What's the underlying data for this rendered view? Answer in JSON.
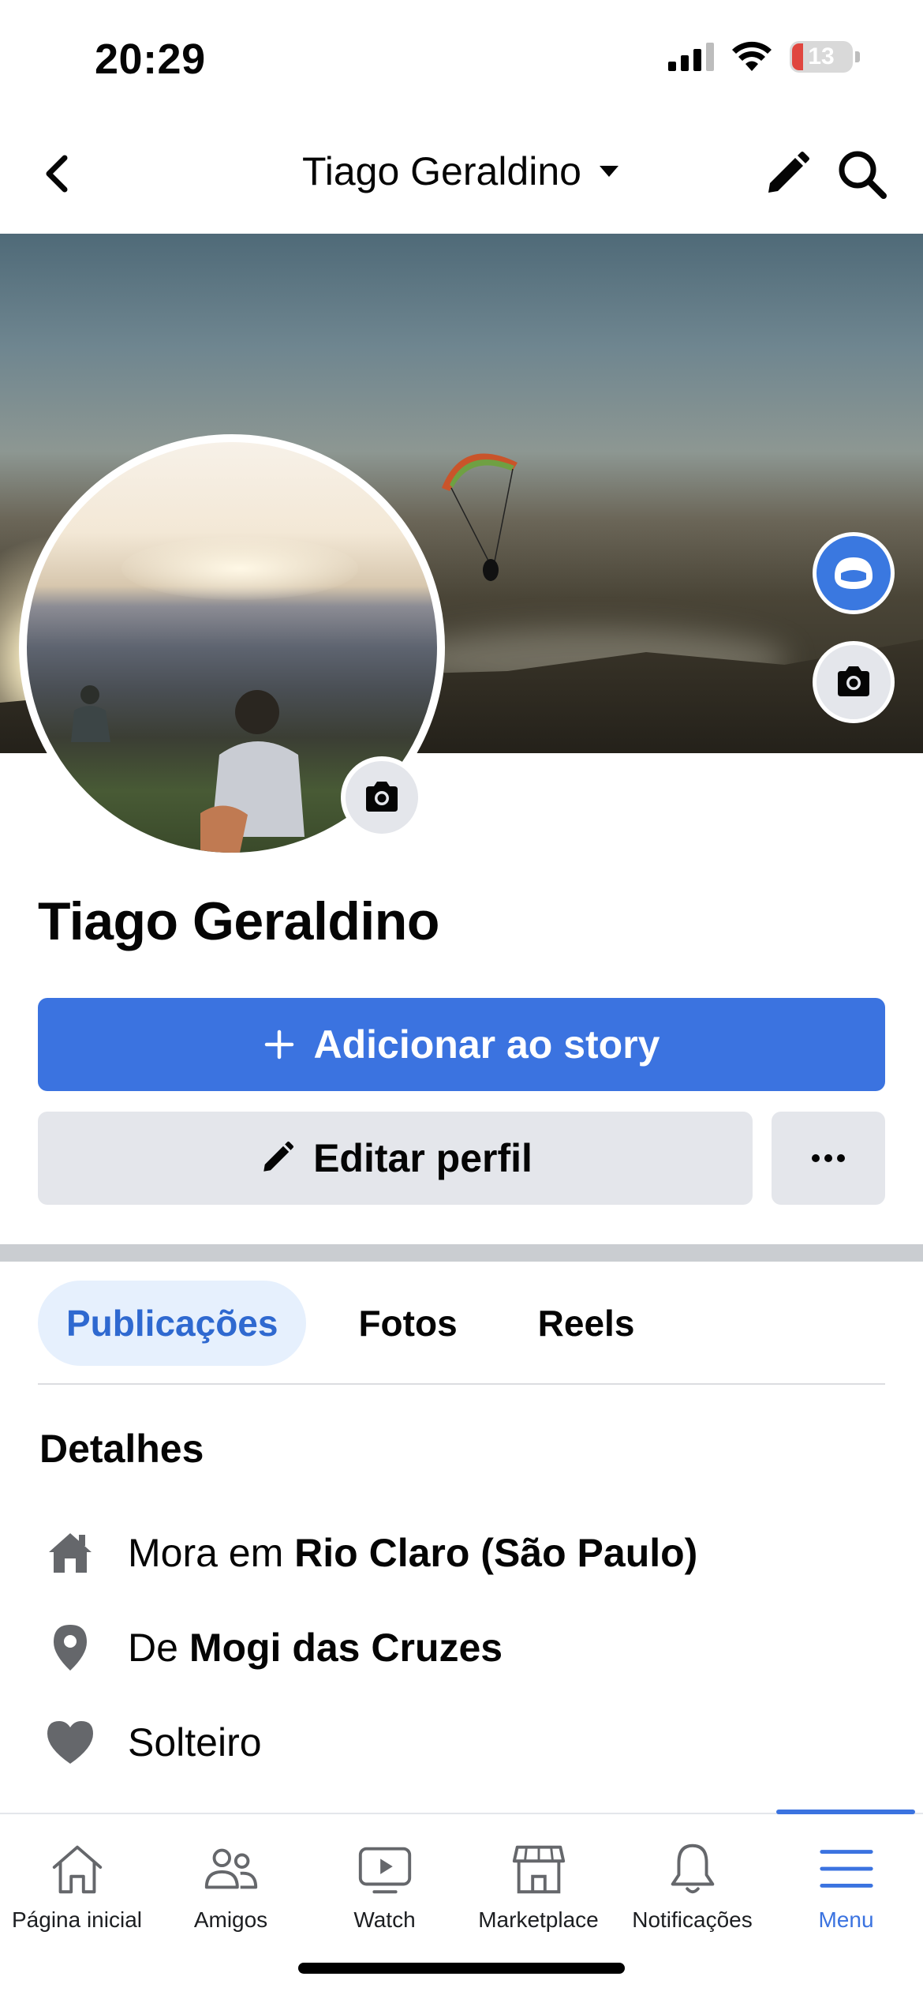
{
  "status_bar": {
    "time": "20:29",
    "battery_level": "13",
    "icons": [
      "signal-icon",
      "wifi-icon",
      "battery-icon"
    ]
  },
  "header": {
    "title": "Tiago Geraldino",
    "icons": [
      "back-chevron-icon",
      "caret-down-icon",
      "pencil-icon",
      "search-icon"
    ]
  },
  "profile": {
    "name": "Tiago Geraldino"
  },
  "actions": {
    "add_story_label": "Adicionar ao story",
    "edit_profile_label": "Editar perfil",
    "more_label": "•••"
  },
  "tabs": [
    {
      "label": "Publicações",
      "active": true
    },
    {
      "label": "Fotos",
      "active": false
    },
    {
      "label": "Reels",
      "active": false
    }
  ],
  "details": {
    "title": "Detalhes",
    "items": [
      {
        "icon": "house-icon",
        "prefix": "Mora em ",
        "value": "Rio Claro (São Paulo)"
      },
      {
        "icon": "location-pin-icon",
        "prefix": "De ",
        "value": "Mogi das Cruzes"
      },
      {
        "icon": "heart-icon",
        "prefix": "Solteiro",
        "value": ""
      }
    ]
  },
  "bottom_nav": [
    {
      "label": "Página inicial",
      "icon": "home-icon",
      "active": false
    },
    {
      "label": "Amigos",
      "icon": "friends-icon",
      "active": false
    },
    {
      "label": "Watch",
      "icon": "watch-icon",
      "active": false
    },
    {
      "label": "Marketplace",
      "icon": "marketplace-icon",
      "active": false
    },
    {
      "label": "Notificações",
      "icon": "bell-icon",
      "active": false
    },
    {
      "label": "Menu",
      "icon": "menu-icon",
      "active": true
    }
  ],
  "colors": {
    "accent": "#3b73e0",
    "secondary_button": "#e4e6eb",
    "active_tab_bg": "#e6f0fd"
  }
}
